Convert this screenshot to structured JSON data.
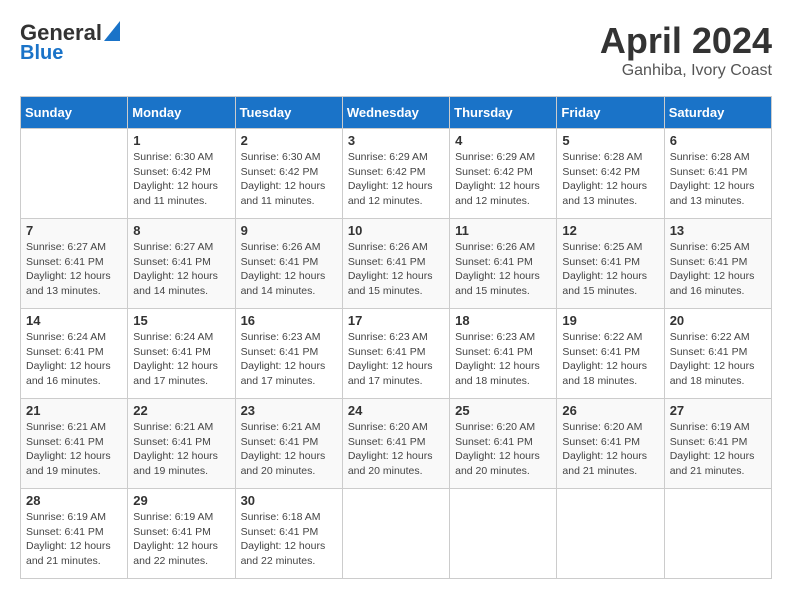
{
  "header": {
    "logo_line1": "General",
    "logo_line2": "Blue",
    "month": "April 2024",
    "location": "Ganhiba, Ivory Coast"
  },
  "weekdays": [
    "Sunday",
    "Monday",
    "Tuesday",
    "Wednesday",
    "Thursday",
    "Friday",
    "Saturday"
  ],
  "weeks": [
    [
      {
        "day": "",
        "info": ""
      },
      {
        "day": "1",
        "info": "Sunrise: 6:30 AM\nSunset: 6:42 PM\nDaylight: 12 hours\nand 11 minutes."
      },
      {
        "day": "2",
        "info": "Sunrise: 6:30 AM\nSunset: 6:42 PM\nDaylight: 12 hours\nand 11 minutes."
      },
      {
        "day": "3",
        "info": "Sunrise: 6:29 AM\nSunset: 6:42 PM\nDaylight: 12 hours\nand 12 minutes."
      },
      {
        "day": "4",
        "info": "Sunrise: 6:29 AM\nSunset: 6:42 PM\nDaylight: 12 hours\nand 12 minutes."
      },
      {
        "day": "5",
        "info": "Sunrise: 6:28 AM\nSunset: 6:42 PM\nDaylight: 12 hours\nand 13 minutes."
      },
      {
        "day": "6",
        "info": "Sunrise: 6:28 AM\nSunset: 6:41 PM\nDaylight: 12 hours\nand 13 minutes."
      }
    ],
    [
      {
        "day": "7",
        "info": "Sunrise: 6:27 AM\nSunset: 6:41 PM\nDaylight: 12 hours\nand 13 minutes."
      },
      {
        "day": "8",
        "info": "Sunrise: 6:27 AM\nSunset: 6:41 PM\nDaylight: 12 hours\nand 14 minutes."
      },
      {
        "day": "9",
        "info": "Sunrise: 6:26 AM\nSunset: 6:41 PM\nDaylight: 12 hours\nand 14 minutes."
      },
      {
        "day": "10",
        "info": "Sunrise: 6:26 AM\nSunset: 6:41 PM\nDaylight: 12 hours\nand 15 minutes."
      },
      {
        "day": "11",
        "info": "Sunrise: 6:26 AM\nSunset: 6:41 PM\nDaylight: 12 hours\nand 15 minutes."
      },
      {
        "day": "12",
        "info": "Sunrise: 6:25 AM\nSunset: 6:41 PM\nDaylight: 12 hours\nand 15 minutes."
      },
      {
        "day": "13",
        "info": "Sunrise: 6:25 AM\nSunset: 6:41 PM\nDaylight: 12 hours\nand 16 minutes."
      }
    ],
    [
      {
        "day": "14",
        "info": "Sunrise: 6:24 AM\nSunset: 6:41 PM\nDaylight: 12 hours\nand 16 minutes."
      },
      {
        "day": "15",
        "info": "Sunrise: 6:24 AM\nSunset: 6:41 PM\nDaylight: 12 hours\nand 17 minutes."
      },
      {
        "day": "16",
        "info": "Sunrise: 6:23 AM\nSunset: 6:41 PM\nDaylight: 12 hours\nand 17 minutes."
      },
      {
        "day": "17",
        "info": "Sunrise: 6:23 AM\nSunset: 6:41 PM\nDaylight: 12 hours\nand 17 minutes."
      },
      {
        "day": "18",
        "info": "Sunrise: 6:23 AM\nSunset: 6:41 PM\nDaylight: 12 hours\nand 18 minutes."
      },
      {
        "day": "19",
        "info": "Sunrise: 6:22 AM\nSunset: 6:41 PM\nDaylight: 12 hours\nand 18 minutes."
      },
      {
        "day": "20",
        "info": "Sunrise: 6:22 AM\nSunset: 6:41 PM\nDaylight: 12 hours\nand 18 minutes."
      }
    ],
    [
      {
        "day": "21",
        "info": "Sunrise: 6:21 AM\nSunset: 6:41 PM\nDaylight: 12 hours\nand 19 minutes."
      },
      {
        "day": "22",
        "info": "Sunrise: 6:21 AM\nSunset: 6:41 PM\nDaylight: 12 hours\nand 19 minutes."
      },
      {
        "day": "23",
        "info": "Sunrise: 6:21 AM\nSunset: 6:41 PM\nDaylight: 12 hours\nand 20 minutes."
      },
      {
        "day": "24",
        "info": "Sunrise: 6:20 AM\nSunset: 6:41 PM\nDaylight: 12 hours\nand 20 minutes."
      },
      {
        "day": "25",
        "info": "Sunrise: 6:20 AM\nSunset: 6:41 PM\nDaylight: 12 hours\nand 20 minutes."
      },
      {
        "day": "26",
        "info": "Sunrise: 6:20 AM\nSunset: 6:41 PM\nDaylight: 12 hours\nand 21 minutes."
      },
      {
        "day": "27",
        "info": "Sunrise: 6:19 AM\nSunset: 6:41 PM\nDaylight: 12 hours\nand 21 minutes."
      }
    ],
    [
      {
        "day": "28",
        "info": "Sunrise: 6:19 AM\nSunset: 6:41 PM\nDaylight: 12 hours\nand 21 minutes."
      },
      {
        "day": "29",
        "info": "Sunrise: 6:19 AM\nSunset: 6:41 PM\nDaylight: 12 hours\nand 22 minutes."
      },
      {
        "day": "30",
        "info": "Sunrise: 6:18 AM\nSunset: 6:41 PM\nDaylight: 12 hours\nand 22 minutes."
      },
      {
        "day": "",
        "info": ""
      },
      {
        "day": "",
        "info": ""
      },
      {
        "day": "",
        "info": ""
      },
      {
        "day": "",
        "info": ""
      }
    ]
  ]
}
